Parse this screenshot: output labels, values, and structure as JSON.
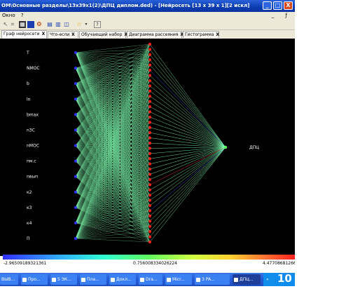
{
  "window": {
    "title": "OM\\Основные разделы\\13х39х1(2)\\ДПЦ диплом.ded) - [Нейросеть [13 x 39 x 1][2 искл]",
    "minimize": "_",
    "maximize": "□",
    "close": "X"
  },
  "menu": {
    "items": [
      "Окно",
      "?"
    ],
    "mdi_minimize": "_",
    "mdi_restore": "ƒ"
  },
  "toolbar": {
    "icons": [
      "cursor-icon",
      "grid-icon",
      "chart-icon",
      "table-icon",
      "layout-icon",
      "layers-icon",
      "window-icon",
      "star-icon",
      "help-icon"
    ]
  },
  "tabs": [
    {
      "label": "Граф нейросети",
      "close": "X",
      "active": true
    },
    {
      "label": "Что-если",
      "close": "X"
    },
    {
      "label": "Обучающий набор",
      "close": "X"
    },
    {
      "label": "Диаграмма рассеяния",
      "close": "X"
    },
    {
      "label": "Гистограмма",
      "close": "X"
    }
  ],
  "network": {
    "inputs": [
      "T",
      "NMOC",
      "b",
      "ln",
      "bmax",
      "n3C",
      "nMOC",
      "пм.с",
      "nвып",
      "к2",
      "к3",
      "к4",
      "П"
    ],
    "hidden_count": 39,
    "output": "ДПЦ",
    "colors": {
      "input_node": "#3030ff",
      "hidden_node": "#ff2020",
      "output_node": "#60ff60",
      "edge": "#80ffb0"
    }
  },
  "scale": {
    "min": "-2.96509189321361",
    "mid": "0.756008334026224",
    "max": "4.47708681266"
  },
  "taskbar": {
    "items": [
      "ВЫВ...",
      "Про...",
      "5 ЭК...",
      "Пла...",
      "Докл...",
      "Dra...",
      "Micr...",
      "3 PA...",
      "ДПЦ..."
    ],
    "tray": "«",
    "clock": "10"
  }
}
